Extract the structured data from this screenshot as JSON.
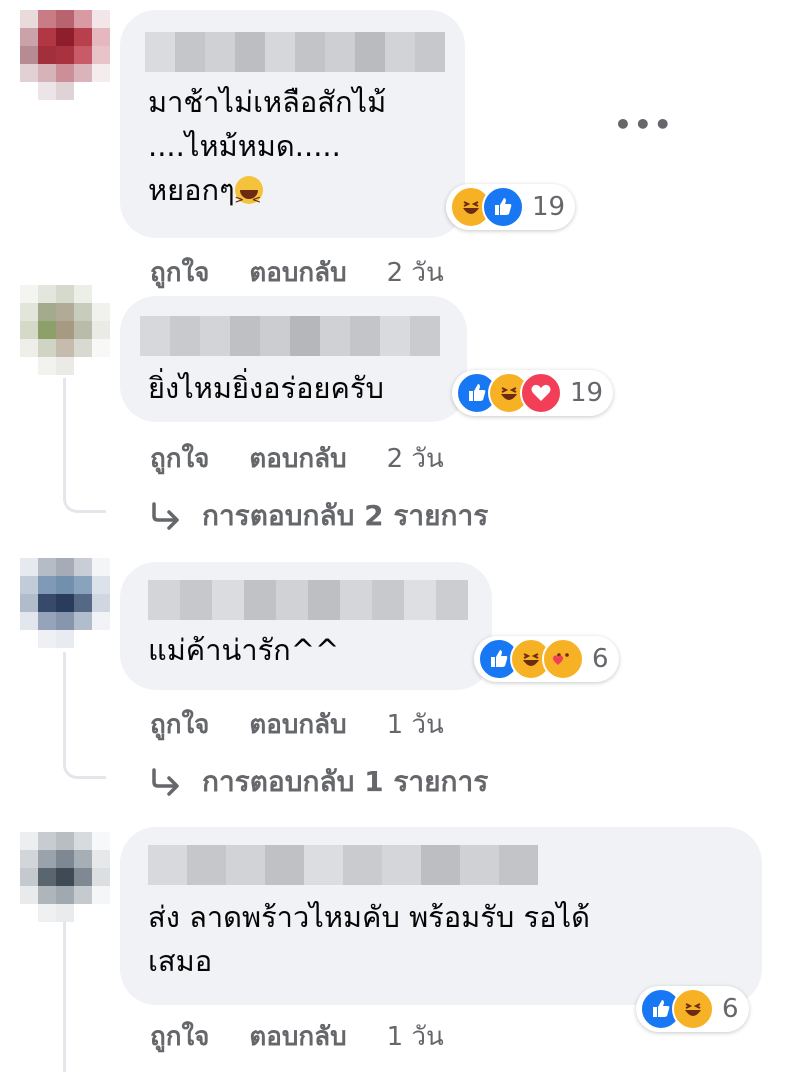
{
  "colors": {
    "bubble": "#f0f2f5",
    "secondary_text": "#65676b",
    "like": "#1877f2",
    "love": "#f33e58",
    "haha": "#f7b125"
  },
  "comments": [
    {
      "lines": [
        "มาช้าไม่เหลือสักไม้",
        "....ไหม้หมด.....",
        "หยอกๆ"
      ],
      "reactions": [
        "haha",
        "like"
      ],
      "reaction_count": "19",
      "actions": {
        "like": "ถูกใจ",
        "reply": "ตอบกลับ",
        "time": "2 วัน"
      }
    },
    {
      "lines": [
        "ยิ่งไหมยิ่งอร่อยครับ"
      ],
      "reactions": [
        "like",
        "haha",
        "love"
      ],
      "reaction_count": "19",
      "actions": {
        "like": "ถูกใจ",
        "reply": "ตอบกลับ",
        "time": "2 วัน"
      },
      "replies_label": "การตอบกลับ 2 รายการ"
    },
    {
      "lines": [
        "แม่ค้าน่ารัก^^"
      ],
      "reactions": [
        "like",
        "haha",
        "care"
      ],
      "reaction_count": "6",
      "actions": {
        "like": "ถูกใจ",
        "reply": "ตอบกลับ",
        "time": "1 วัน"
      },
      "replies_label": "การตอบกลับ 1 รายการ"
    },
    {
      "lines": [
        "ส่ง ลาดพร้าวไหมคับ พร้อมรับ รอได้",
        "เสมอ"
      ],
      "reactions": [
        "like",
        "haha"
      ],
      "reaction_count": "6",
      "actions": {
        "like": "ถูกใจ",
        "reply": "ตอบกลับ",
        "time": "1 วัน"
      }
    }
  ],
  "icons": {
    "more": "more-options-icon",
    "reply_arrow": "reply-arrow-icon",
    "inline_emoji": "grinning-squinting-face-emoji"
  }
}
